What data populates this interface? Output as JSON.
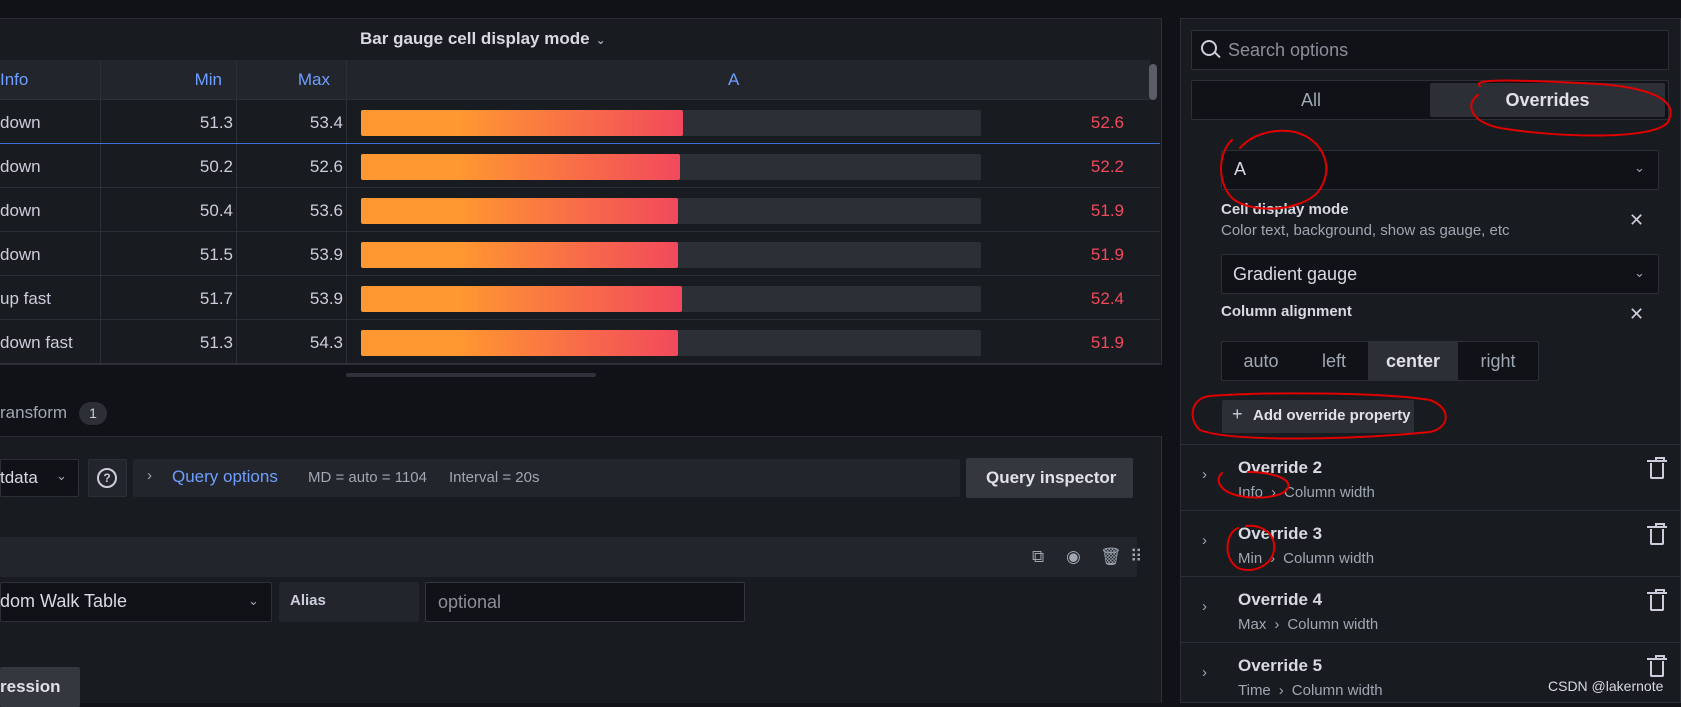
{
  "panel": {
    "title": "Bar gauge cell display mode",
    "columns": {
      "info": "Info",
      "min": "Min",
      "max": "Max",
      "a": "A"
    },
    "rows": [
      {
        "info": "down",
        "min": "51.3",
        "max": "53.4",
        "a": "52.6",
        "gauge_fraction": 0.52
      },
      {
        "info": "down",
        "min": "50.2",
        "max": "52.6",
        "a": "52.2",
        "gauge_fraction": 0.515
      },
      {
        "info": "down",
        "min": "50.4",
        "max": "53.6",
        "a": "51.9",
        "gauge_fraction": 0.512
      },
      {
        "info": "down",
        "min": "51.5",
        "max": "53.9",
        "a": "51.9",
        "gauge_fraction": 0.512
      },
      {
        "info": "up fast",
        "min": "51.7",
        "max": "53.9",
        "a": "52.4",
        "gauge_fraction": 0.517
      },
      {
        "info": "down fast",
        "min": "51.3",
        "max": "54.3",
        "a": "51.9",
        "gauge_fraction": 0.512
      }
    ]
  },
  "transform": {
    "label": "ransform",
    "count": "1"
  },
  "query": {
    "datasource": "tdata",
    "options_label": "Query options",
    "md": "MD = auto = 1104",
    "interval": "Interval = 20s",
    "inspector_label": "Query inspector",
    "scenario": "dom Walk Table",
    "alias_label": "Alias",
    "alias_placeholder": "optional",
    "expression_label": "ression"
  },
  "options": {
    "search_placeholder": "Search options",
    "tabs": [
      "All",
      "Overrides"
    ],
    "field_selected": "A",
    "cell_display": {
      "title": "Cell display mode",
      "description": "Color text, background, show as gauge, etc",
      "value": "Gradient gauge"
    },
    "column_alignment": {
      "title": "Column alignment",
      "options": [
        "auto",
        "left",
        "center",
        "right"
      ],
      "selected": "center"
    },
    "add_override_label": "Add override property",
    "overrides": [
      {
        "title": "Override 2",
        "field": "Info",
        "property": "Column width"
      },
      {
        "title": "Override 3",
        "field": "Min",
        "property": "Column width"
      },
      {
        "title": "Override 4",
        "field": "Max",
        "property": "Column width"
      },
      {
        "title": "Override 5",
        "field": "Time",
        "property": "Column width"
      }
    ]
  },
  "watermark": "CSDN @lakernote",
  "colors": {
    "gauge_start": "#ff9830",
    "gauge_end": "#f2495c",
    "link": "#6e9fff",
    "annotation": "#e00000"
  }
}
